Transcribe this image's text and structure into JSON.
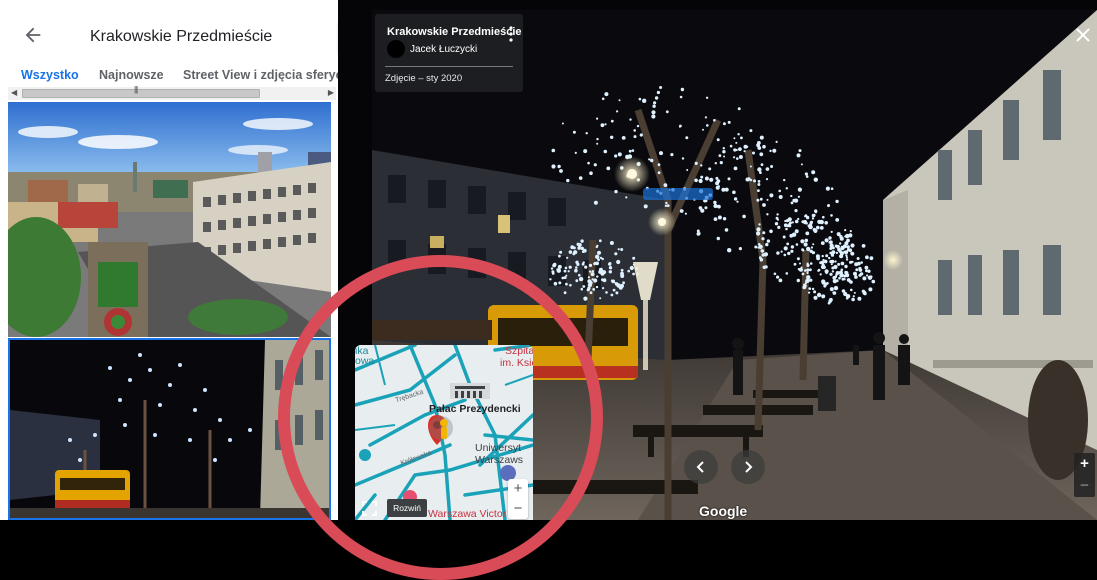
{
  "left_panel": {
    "title": "Krakowskie Przedmieście",
    "tabs": [
      {
        "label": "Wszystko",
        "active": true
      },
      {
        "label": "Najnowsze",
        "active": false
      },
      {
        "label": "Street View i zdjęcia sferyczne",
        "active": false
      }
    ],
    "photos": [
      {
        "description": "aerial-city-view"
      },
      {
        "description": "night-street-lights"
      }
    ]
  },
  "info_card": {
    "title": "Krakowskie Przedmieście",
    "author": "Jacek Łuczycki",
    "date": "Zdjęcie – sty 2020"
  },
  "minimap": {
    "labels": {
      "szpital": "Szpita",
      "szpital2": "im. Księż",
      "palac": "Pałac Prezydencki",
      "uni1": "Uniwersyt",
      "uni2": "Warszaws",
      "station": "Warszawa Victor",
      "street1": "Trębacka",
      "street2": "Królewska",
      "top_left": "ika",
      "top_left2": "owa"
    },
    "expand_label": "Rozwiń",
    "zoom_in": "+",
    "zoom_out": "−"
  },
  "viewer": {
    "watermark": "Google",
    "zoom_in": "+",
    "zoom_out": "−"
  },
  "colors": {
    "accent": "#1a73e8",
    "annotation": "#d94b57",
    "route": "#1aa3b8"
  }
}
